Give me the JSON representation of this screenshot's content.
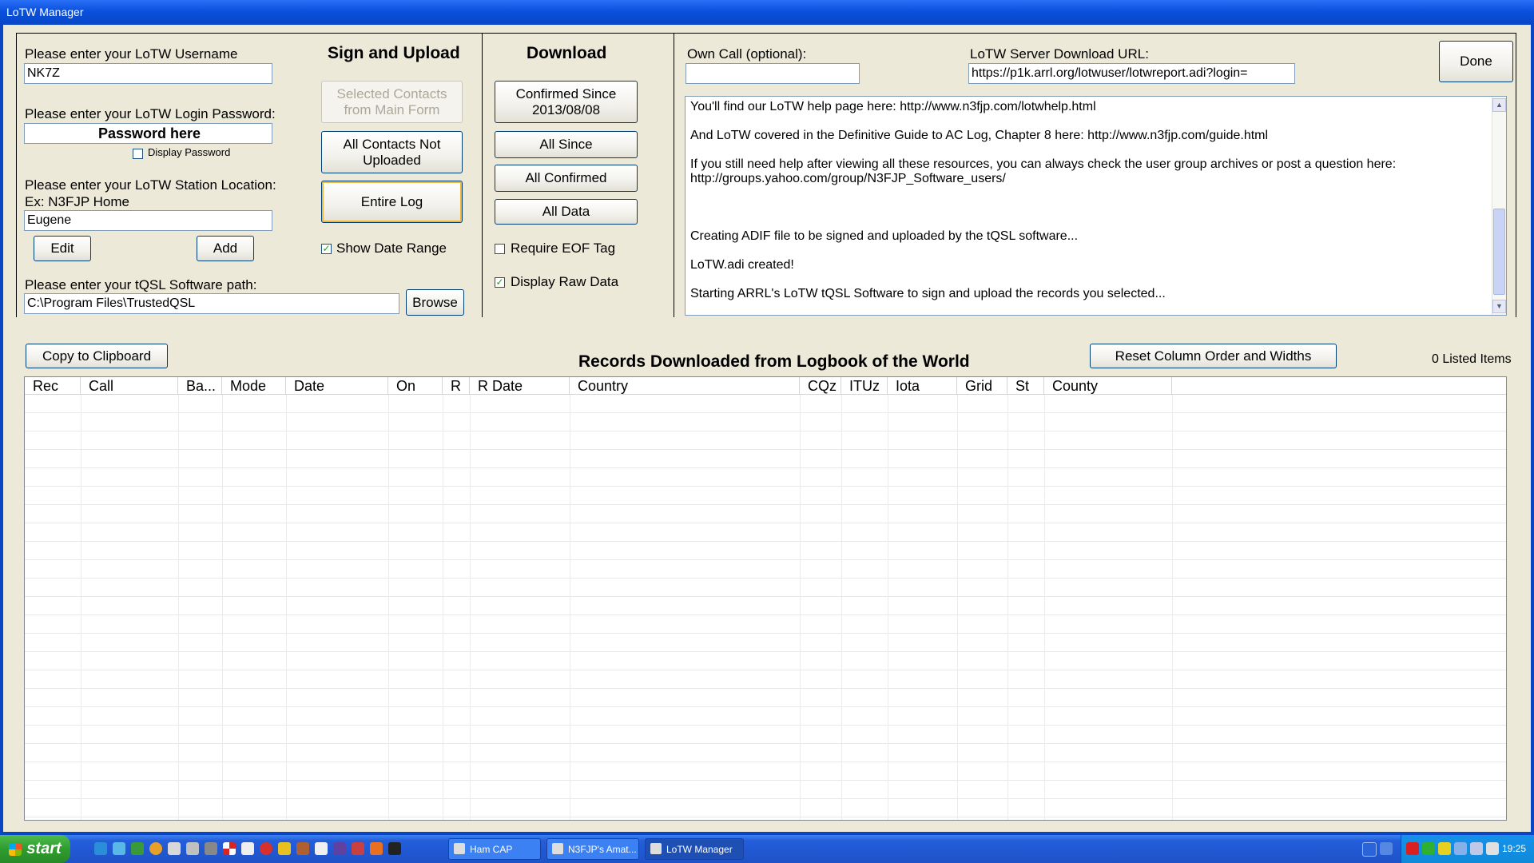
{
  "window": {
    "title": "LoTW Manager"
  },
  "account": {
    "username_label": "Please enter your LoTW Username",
    "username_value": "NK7Z",
    "password_label": "Please enter your LoTW Login Password:",
    "password_value": "Password here",
    "display_password_label": "Display Password",
    "display_password_checked": false,
    "station_label": "Please enter your LoTW Station Location:",
    "station_example": "Ex: N3FJP Home",
    "station_value": "Eugene",
    "edit_label": "Edit",
    "add_label": "Add",
    "tqsl_label": "Please enter your tQSL Software path:",
    "tqsl_value": "C:\\Program Files\\TrustedQSL",
    "browse_label": "Browse"
  },
  "sign_upload": {
    "heading": "Sign and Upload",
    "selected_contacts_line1": "Selected Contacts",
    "selected_contacts_line2": "from Main Form",
    "all_not_uploaded_line1": "All Contacts Not",
    "all_not_uploaded_line2": "Uploaded",
    "entire_log": "Entire Log",
    "show_date_range_label": "Show Date Range",
    "show_date_range_checked": true
  },
  "download": {
    "heading": "Download",
    "confirmed_since_line1": "Confirmed Since",
    "confirmed_since_line2": "2013/08/08",
    "all_since": "All Since",
    "all_confirmed": "All Confirmed",
    "all_data": "All Data",
    "require_eof_label": "Require EOF Tag",
    "require_eof_checked": false,
    "display_raw_label": "Display Raw Data",
    "display_raw_checked": true
  },
  "server": {
    "own_call_label": "Own Call (optional):",
    "own_call_value": "",
    "url_label": "LoTW Server Download URL:",
    "url_value": "https://p1k.arrl.org/lotwuser/lotwreport.adi?login=",
    "done_label": "Done"
  },
  "log_lines": [
    "You'll find our LoTW help page here:  http://www.n3fjp.com/lotwhelp.html",
    "And LoTW covered in the Definitive Guide to AC Log, Chapter 8 here:  http://www.n3fjp.com/guide.html",
    "If you still need help after viewing all these resources, you can always check the user group archives or post a question here:",
    "http://groups.yahoo.com/group/N3FJP_Software_users/",
    "Creating ADIF file to be signed and uploaded by the tQSL software...",
    "LoTW.adi created!",
    "Starting ARRL's LoTW tQSL Software to sign and upload the records you selected..."
  ],
  "records": {
    "copy_label": "Copy to Clipboard",
    "title": "Records Downloaded from Logbook of the World",
    "reset_label": "Reset Column Order and Widths",
    "listed_items": "0 Listed Items",
    "columns": [
      "Rec",
      "Call",
      "Ba...",
      "Mode",
      "Date",
      "On",
      "R",
      "R Date",
      "Country",
      "CQz",
      "ITUz",
      "Iota",
      "Grid",
      "St",
      "County"
    ]
  },
  "taskbar": {
    "start_label": "start",
    "tasks": [
      "Ham CAP",
      "N3FJP's Amat...",
      "LoTW Manager"
    ],
    "clock": "19:25"
  },
  "colors": {
    "titlebar": "#0a50dd",
    "window_bg": "#ece9d8",
    "taskbar": "#245edb",
    "start": "#2f9c2f"
  }
}
